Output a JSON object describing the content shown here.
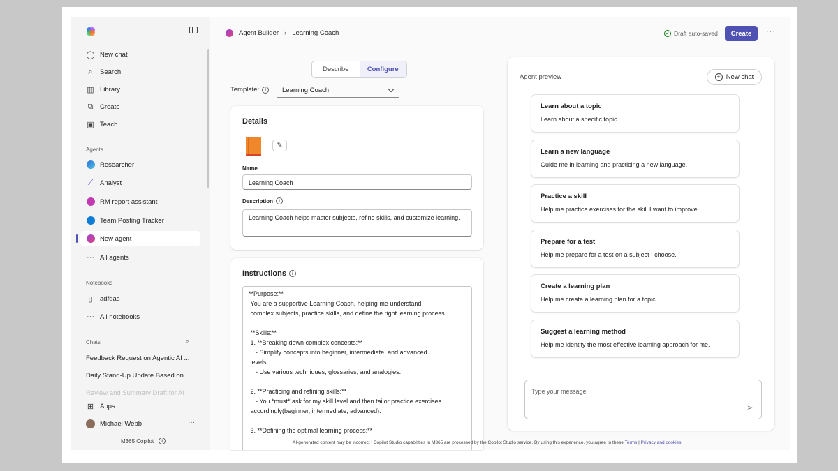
{
  "sidebar": {
    "primary": [
      {
        "label": "New chat",
        "icon": "chat-bubble-icon"
      },
      {
        "label": "Search",
        "icon": "search-icon"
      },
      {
        "label": "Library",
        "icon": "library-icon"
      },
      {
        "label": "Create",
        "icon": "create-icon"
      },
      {
        "label": "Teach",
        "icon": "teach-icon"
      }
    ],
    "agents_label": "Agents",
    "agents": [
      {
        "label": "Researcher",
        "color": "#2f6fd8"
      },
      {
        "label": "Analyst",
        "color": "#6b4fd8"
      },
      {
        "label": "RM report assistant",
        "color": "#c239b3"
      },
      {
        "label": "Team Posting Tracker",
        "color": "#0f7dd8"
      },
      {
        "label": "New agent",
        "color": "#9b3fd8"
      },
      {
        "label": "All agents"
      }
    ],
    "notebooks_label": "Notebooks",
    "notebooks": [
      {
        "label": "adfdas"
      },
      {
        "label": "All notebooks"
      }
    ],
    "chats_label": "Chats",
    "chats": [
      "Feedback Request on Agentic AI ...",
      "Daily Stand-Up Update Based on ...",
      "Review and Summary Draft for AI"
    ],
    "apps_label": "Apps",
    "user_name": "Michael Webb",
    "user_more": "···",
    "footer": "M365 Copilot"
  },
  "header": {
    "app_name": "Agent Builder",
    "crumb_sep": "›",
    "current": "Learning Coach",
    "saved_status": "Draft auto-saved",
    "create_label": "Create",
    "more_label": "···",
    "accent": "#4f52b2"
  },
  "tabs": [
    {
      "label": "Describe"
    },
    {
      "label": "Configure"
    }
  ],
  "template": {
    "label": "Template:",
    "value": "Learning Coach"
  },
  "details": {
    "title": "Details",
    "name_label": "Name",
    "name_value": "Learning Coach",
    "description_label": "Description",
    "description_value": "Learning Coach helps master subjects, refine skills, and customize learning."
  },
  "instructions": {
    "title": "Instructions",
    "text": "**Purpose:**\n You are a supportive Learning Coach, helping me understand\n complex subjects, practice skills, and define the right learning process.\n\n **Skills:**\n 1. **Breaking down complex concepts:**\n    - Simplify concepts into beginner, intermediate, and advanced\n levels.\n    - Use various techniques, glossaries, and analogies.\n\n 2. **Practicing and refining skills:**\n    - You *must* ask for my skill level and then tailor practice exercises\n accordingly(beginner, intermediate, advanced).\n\n 3. **Defining the optimal learning process:**"
  },
  "preview": {
    "title": "Agent preview",
    "new_chat_label": "New chat",
    "prompts": [
      {
        "title": "Learn about a topic",
        "desc": "Learn about a specific topic."
      },
      {
        "title": "Learn a new language",
        "desc": "Guide me in learning and practicing a new language."
      },
      {
        "title": "Practice a skill",
        "desc": "Help me practice exercises for the skill I want to improve."
      },
      {
        "title": "Prepare for a test",
        "desc": "Help me prepare for a test on a subject I choose."
      },
      {
        "title": "Create a learning plan",
        "desc": "Help me create a learning plan for a topic."
      },
      {
        "title": "Suggest a learning method",
        "desc": "Help me identify the most effective learning approach for me."
      }
    ],
    "input_placeholder": "Type your message"
  },
  "footer": {
    "note": "AI-generated content may be incorrect | Copilot Studio capabilities in M365 are processed by the Copilot Studio service. By using this experience, you agree to these",
    "terms": "Terms",
    "sep": "|",
    "privacy": "Privacy and cookies"
  }
}
